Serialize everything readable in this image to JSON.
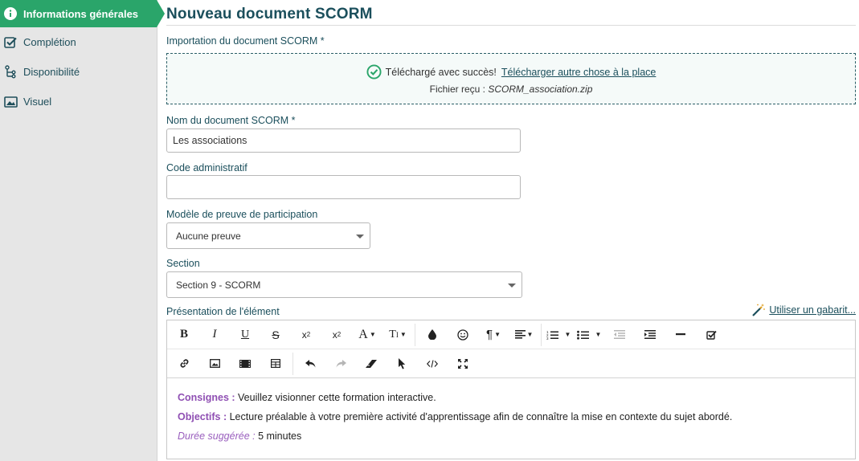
{
  "sidebar": {
    "items": [
      {
        "label": "Informations générales",
        "icon": "info-icon",
        "active": true
      },
      {
        "label": "Complétion",
        "icon": "checkbox-icon",
        "active": false
      },
      {
        "label": "Disponibilité",
        "icon": "tree-icon",
        "active": false
      },
      {
        "label": "Visuel",
        "icon": "image-icon",
        "active": false
      }
    ]
  },
  "page": {
    "title": "Nouveau document SCORM"
  },
  "import": {
    "label": "Importation du document SCORM *",
    "success_text": "Téléchargé avec succès!",
    "replace_link": "Télécharger autre chose à la place",
    "file_prefix": "Fichier reçu : ",
    "file_name": "SCORM_association.zip"
  },
  "form": {
    "name_label": "Nom du document SCORM *",
    "name_value": "Les associations",
    "code_label": "Code administratif",
    "code_value": "",
    "proof_label": "Modèle de preuve de participation",
    "proof_value": "Aucune preuve",
    "section_label": "Section",
    "section_value": "Section 9 - SCORM",
    "presentation_label": "Présentation de l'élément",
    "template_link": "Utiliser un gabarit..."
  },
  "editor": {
    "toolbar_row1": [
      "bold",
      "italic",
      "underline",
      "strikethrough",
      "subscript",
      "superscript",
      "font-size",
      "text-transform",
      "color",
      "emoji",
      "paragraph",
      "align",
      "ordered-list",
      "unordered-list",
      "outdent",
      "indent",
      "horizontal-line",
      "checklist"
    ],
    "toolbar_row2": [
      "link",
      "image",
      "video",
      "table",
      "undo",
      "redo",
      "clear-format",
      "select",
      "code-view",
      "fullscreen"
    ],
    "content": {
      "line1_label": "Consignes",
      "line1_sep": " : ",
      "line1_text": "Veuillez visionner cette formation interactive.",
      "line2_label": "Objectifs",
      "line2_sep": " : ",
      "line2_text": "Lecture préalable à votre première activité d'apprentissage afin de connaître la mise en contexte du sujet abordé.",
      "line3_label": "Durée suggérée : ",
      "line3_text": "5 minutes"
    }
  },
  "colors": {
    "accent_green": "#2aa56a",
    "title_teal": "#1b4f5c",
    "purple": "#8f4fb3"
  }
}
